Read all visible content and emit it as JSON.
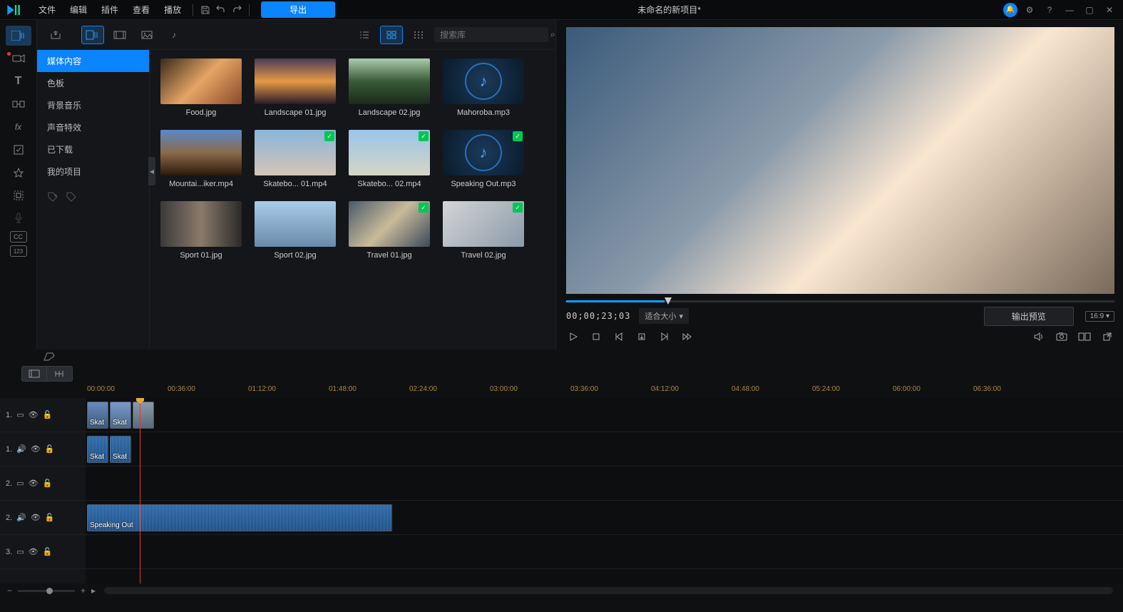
{
  "menu": {
    "file": "文件",
    "edit": "编辑",
    "plugin": "插件",
    "view": "查看",
    "play": "播放"
  },
  "export_btn": "导出",
  "project_title": "未命名的新项目*",
  "search_placeholder": "搜索库",
  "sidebar": {
    "items": [
      "媒体内容",
      "色板",
      "背景音乐",
      "声音特效",
      "已下载",
      "我的项目"
    ]
  },
  "media": [
    {
      "label": "Food.jpg",
      "type": "img",
      "g": "linear-gradient(135deg,#3a2a1a,#e5a565,#8a4a2a)"
    },
    {
      "label": "Landscape 01.jpg",
      "type": "img",
      "g": "linear-gradient(180deg,#4a3a5a,#e59a45,#2a1a2a)"
    },
    {
      "label": "Landscape 02.jpg",
      "type": "img",
      "g": "linear-gradient(180deg,#aaccaa,#3a5a3a,#1a2a1a)"
    },
    {
      "label": "Mahoroba.mp3",
      "type": "audio"
    },
    {
      "label": "Mountai...iker.mp4",
      "type": "img",
      "g": "linear-gradient(180deg,#5a8aca,#8a6a4a,#2a1a0a)"
    },
    {
      "label": "Skatebo... 01.mp4",
      "type": "img",
      "check": true,
      "g": "linear-gradient(180deg,#8ab5da,#d5c5b5)"
    },
    {
      "label": "Skatebo... 02.mp4",
      "type": "img",
      "check": true,
      "g": "linear-gradient(180deg,#9ac5ea,#d5d5c5)"
    },
    {
      "label": "Speaking Out.mp3",
      "type": "audio",
      "check": true
    },
    {
      "label": "Sport 01.jpg",
      "type": "img",
      "g": "linear-gradient(90deg,#3a3a3a,#8a7a6a,#2a2a2a)"
    },
    {
      "label": "Sport 02.jpg",
      "type": "img",
      "g": "linear-gradient(180deg,#aaccea,#6a8aaa)"
    },
    {
      "label": "Travel 01.jpg",
      "type": "img",
      "check": true,
      "g": "linear-gradient(135deg,#4a5a6a,#caba9a,#3a4a5a)"
    },
    {
      "label": "Travel 02.jpg",
      "type": "img",
      "check": true,
      "g": "linear-gradient(135deg,#d5d5d5,#8a9aaa)"
    }
  ],
  "preview": {
    "timecode": "00;00;23;03",
    "fit": "适合大小",
    "output_preview": "输出预览",
    "aspect": "16:9"
  },
  "ruler": [
    "00:00:00",
    "00:36:00",
    "01:12:00",
    "01:48:00",
    "02:24:00",
    "03:00:00",
    "03:36:00",
    "04:12:00",
    "04:48:00",
    "05:24:00",
    "06:00:00",
    "06:36:00"
  ],
  "tracks": {
    "v1": "1.",
    "a1": "1.",
    "v2": "2.",
    "a2": "2.",
    "v3": "3."
  },
  "clips": {
    "skat1": "Skat",
    "skat2": "Skat",
    "speaking": "Speaking Out"
  }
}
